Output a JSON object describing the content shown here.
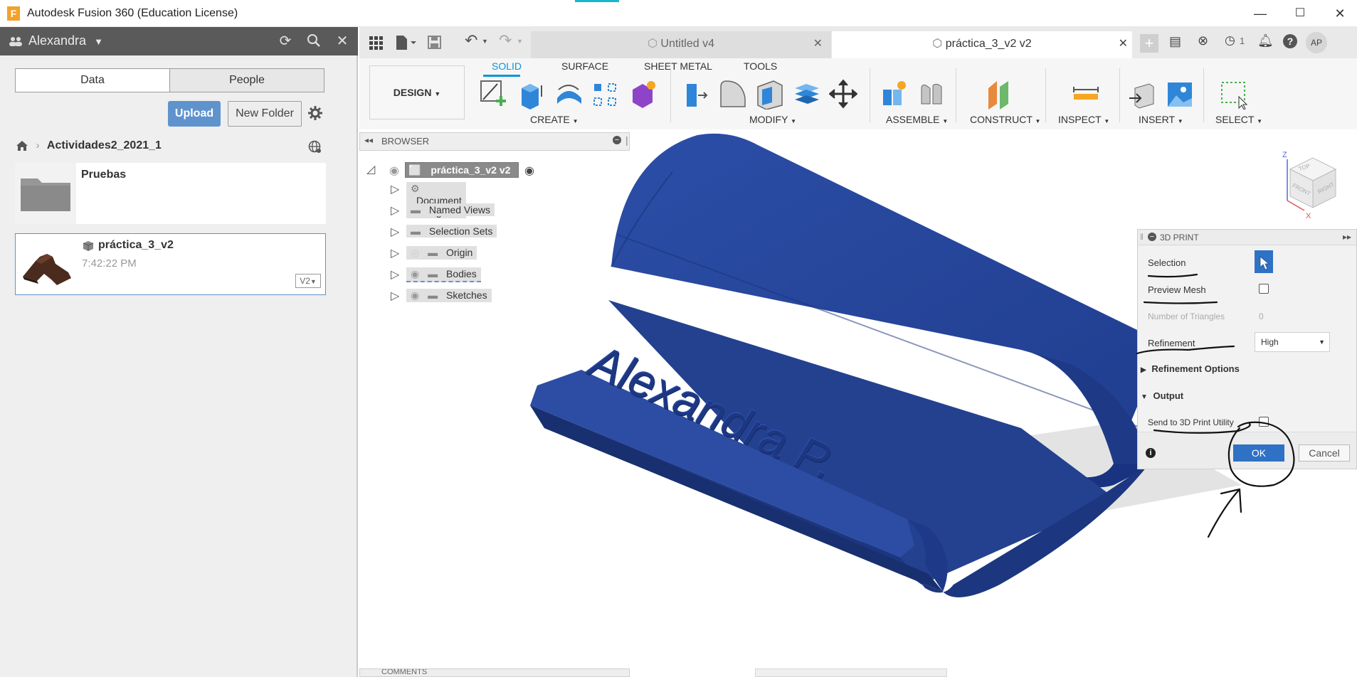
{
  "window": {
    "app_icon": "F",
    "title": "Autodesk Fusion 360 (Education License)",
    "minimize": "—",
    "maximize": "☐",
    "close": "✕"
  },
  "data_panel": {
    "user": "Alexandra",
    "tabs": [
      "Data",
      "People"
    ],
    "upload_label": "Upload",
    "new_folder_label": "New Folder",
    "breadcrumb": "Actividades2_2021_1",
    "folder": {
      "name": "Pruebas"
    },
    "design": {
      "name": "práctica_3_v2",
      "time": "7:42:22 PM",
      "version": "V2"
    }
  },
  "doc_tabs": [
    {
      "label": "Untitled v4",
      "active": false
    },
    {
      "label": "práctica_3_v2 v2",
      "active": true
    }
  ],
  "header_right": {
    "jobs_count": "1",
    "avatar": "AP"
  },
  "toolbar": {
    "workspace": "DESIGN",
    "categories": [
      "SOLID",
      "SURFACE",
      "SHEET METAL",
      "TOOLS"
    ],
    "active_category": "SOLID",
    "groups": [
      "CREATE",
      "MODIFY",
      "ASSEMBLE",
      "CONSTRUCT",
      "INSPECT",
      "INSERT",
      "SELECT"
    ]
  },
  "browser": {
    "title": "BROWSER",
    "root": "práctica_3_v2 v2",
    "items": [
      "Document Settings",
      "Named Views",
      "Selection Sets",
      "Origin",
      "Bodies",
      "Sketches"
    ]
  },
  "model": {
    "engraved_text": "Alexandra P.",
    "color": "#233f8f"
  },
  "viewcube": {
    "top": "TOP",
    "front": "FRONT",
    "right": "RIGHT",
    "axis_x": "X",
    "axis_z": "Z"
  },
  "print_dialog": {
    "title": "3D PRINT",
    "selection_label": "Selection",
    "preview_mesh_label": "Preview Mesh",
    "triangles_label": "Number of Triangles",
    "triangles_value": "0",
    "refinement_label": "Refinement",
    "refinement_value": "High",
    "refinement_options_label": "Refinement Options",
    "output_label": "Output",
    "send_label": "Send to 3D Print Utility",
    "ok_label": "OK",
    "cancel_label": "Cancel"
  },
  "bottom": {
    "comments_label": "COMMENTS"
  },
  "colors": {
    "accent": "#0696d7",
    "upload": "#5f93cd",
    "ok": "#2f71c5",
    "model": "#233f8f",
    "header": "#5a5a5a"
  }
}
